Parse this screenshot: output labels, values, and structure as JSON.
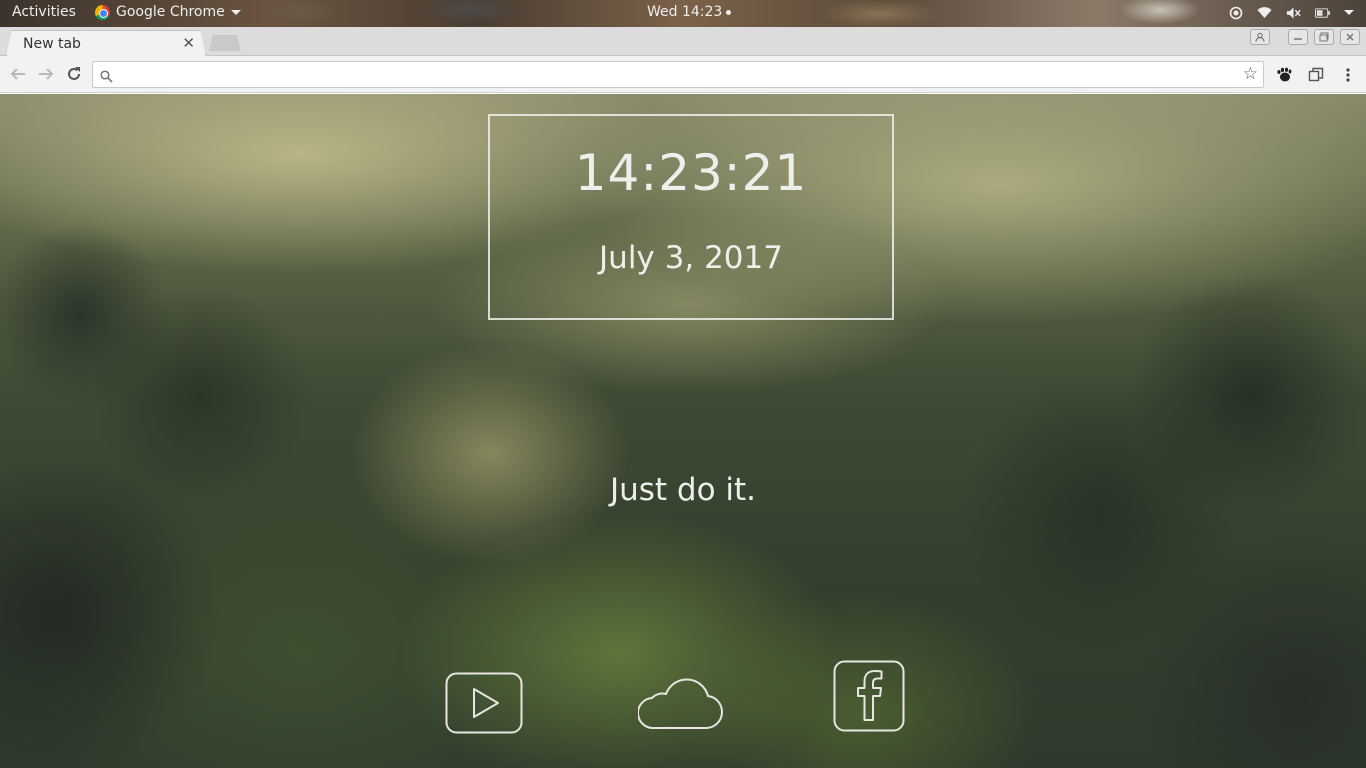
{
  "topbar": {
    "activities": "Activities",
    "app_name": "Google Chrome",
    "clock": "Wed 14:23"
  },
  "browser": {
    "tab_title": "New tab",
    "omnibox": {
      "value": "",
      "placeholder": ""
    }
  },
  "newtab": {
    "time": "14:23:21",
    "date": "July 3, 2017",
    "motto": "Just do it.",
    "quick_links": [
      {
        "icon": "youtube-play-icon"
      },
      {
        "icon": "cloud-icon"
      },
      {
        "icon": "facebook-icon"
      }
    ]
  },
  "colors": {
    "chrome_toolbar": "#f2f2f2",
    "tabstrip": "#dcdcdc",
    "overlay_text": "#eeeeea"
  }
}
